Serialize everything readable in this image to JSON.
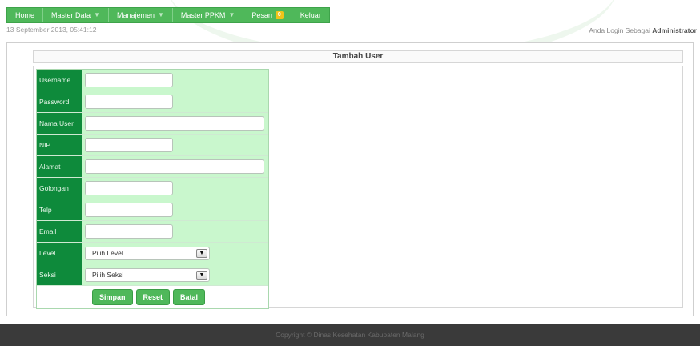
{
  "nav": {
    "items": [
      {
        "label": "Home",
        "dropdown": false
      },
      {
        "label": "Master Data",
        "dropdown": true
      },
      {
        "label": "Manajemen",
        "dropdown": true
      },
      {
        "label": "Master PPKM",
        "dropdown": true
      },
      {
        "label": "Pesan",
        "badge": "0"
      },
      {
        "label": "Keluar",
        "dropdown": false
      }
    ]
  },
  "header": {
    "datetime": "13 September 2013, 05:41:12",
    "login_prefix": "Anda Login Sebagai",
    "login_role": "Administrator"
  },
  "form": {
    "title": "Tambah User",
    "fields": {
      "username": {
        "label": "Username",
        "value": ""
      },
      "password": {
        "label": "Password",
        "value": ""
      },
      "nama_user": {
        "label": "Nama User",
        "value": ""
      },
      "nip": {
        "label": "NIP",
        "value": ""
      },
      "alamat": {
        "label": "Alamat",
        "value": ""
      },
      "golongan": {
        "label": "Golongan",
        "value": ""
      },
      "telp": {
        "label": "Telp",
        "value": ""
      },
      "email": {
        "label": "Email",
        "value": ""
      },
      "level": {
        "label": "Level",
        "selected": "Pilih Level"
      },
      "seksi": {
        "label": "Seksi",
        "selected": "Pilih Seksi"
      }
    },
    "buttons": {
      "simpan": "Simpan",
      "reset": "Reset",
      "batal": "Batal"
    }
  },
  "footer": {
    "text": "Copyright © Dinas Kesehatan Kabupaten Malang"
  },
  "colors": {
    "nav_green": "#4fb85a",
    "label_green": "#0e8a3b",
    "field_green": "#c9f7cd",
    "footer_bg": "#3a3a3a"
  }
}
